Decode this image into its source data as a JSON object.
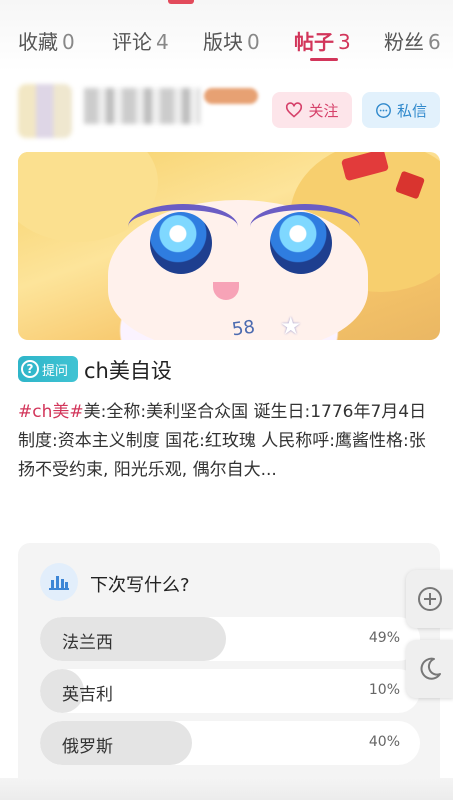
{
  "tabs": [
    {
      "label": "收藏",
      "count": "0"
    },
    {
      "label": "评论",
      "count": "4"
    },
    {
      "label": "版块",
      "count": "0"
    },
    {
      "label": "帖子",
      "count": "3"
    },
    {
      "label": "粉丝",
      "count": "6"
    }
  ],
  "active_tab": "帖子",
  "author": {
    "follow_label": "关注",
    "message_label": "私信"
  },
  "post": {
    "badge": "提问",
    "title": "ch美自设",
    "hashtag": "#ch美#",
    "body": "美:全称:美利坚合众国 诞生日:1776年7月4日制度:资本主义制度 国花:红玫瑰 人民称呼:鹰酱性格:张扬不受约束, 阳光乐观, 偶尔自大..."
  },
  "banner_art": {
    "printed_number": "58"
  },
  "poll": {
    "question": "下次写什么?",
    "options": [
      {
        "label": "法兰西",
        "percent": "49%",
        "share": 0.49
      },
      {
        "label": "英吉利",
        "percent": "10%",
        "share": 0.1
      },
      {
        "label": "俄罗斯",
        "percent": "40%",
        "share": 0.4
      }
    ]
  },
  "icons": {
    "follow": "heart-outline-icon",
    "message": "chat-bubble-icon",
    "poll": "bar-chart-icon",
    "add": "plus-circle-icon",
    "theme": "moon-icon"
  },
  "colors": {
    "accent": "#d2355a",
    "follow_bg": "#fde5ea",
    "message_bg": "#e2f1fc",
    "badge": "#2fb5c9",
    "poll_bg": "#f4f4f4"
  }
}
